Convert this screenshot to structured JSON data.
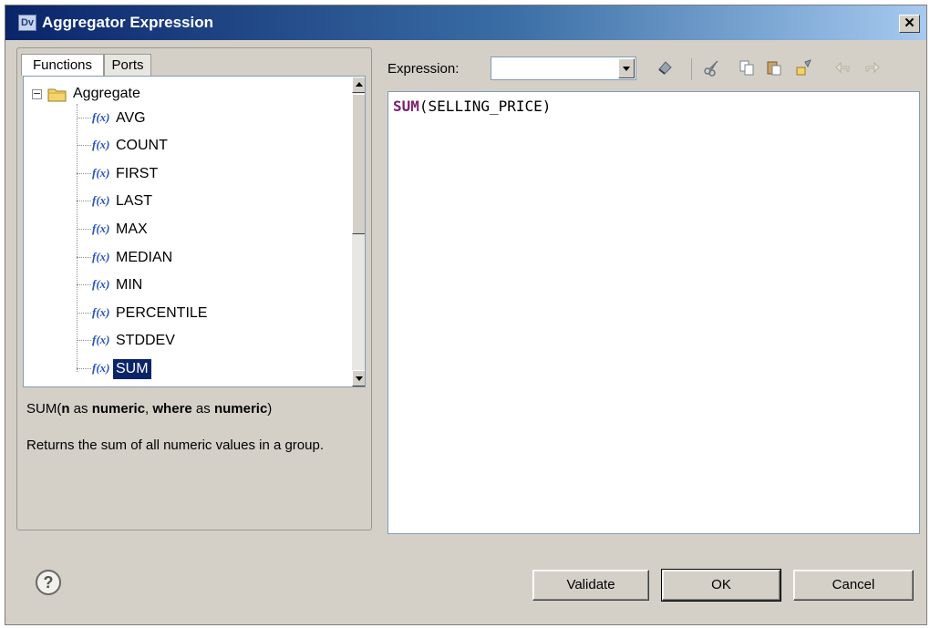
{
  "window": {
    "app_badge": "Dv",
    "title": "Aggregator Expression",
    "close_glyph": "✕"
  },
  "tabs": [
    {
      "label": "Functions"
    },
    {
      "label": "Ports"
    }
  ],
  "tree": {
    "expander": "−",
    "root_label": "Aggregate",
    "fx_glyph": "f(x)",
    "items": [
      {
        "label": "AVG"
      },
      {
        "label": "COUNT"
      },
      {
        "label": "FIRST"
      },
      {
        "label": "LAST"
      },
      {
        "label": "MAX"
      },
      {
        "label": "MEDIAN"
      },
      {
        "label": "MIN"
      },
      {
        "label": "PERCENTILE"
      },
      {
        "label": "STDDEV"
      },
      {
        "label": "SUM"
      }
    ],
    "selected": "SUM"
  },
  "description": {
    "sig_func": "SUM(",
    "sig_arg1": "n",
    "sig_as1": " as ",
    "sig_type1": "numeric",
    "sig_comma": ", ",
    "sig_arg2": "where",
    "sig_as2": " as ",
    "sig_type2": "numeric",
    "sig_close": ")",
    "text": "Returns the sum of all numeric values in a group."
  },
  "expression": {
    "label": "Expression:",
    "combo_value": "",
    "keyword": "SUM",
    "rest": "(SELLING_PRICE)"
  },
  "toolbar_icons": [
    "eraser-icon",
    "cut-icon",
    "copy-icon",
    "paste-icon",
    "format-icon",
    "undo-icon",
    "redo-icon"
  ],
  "buttons": {
    "validate": "Validate",
    "ok": "OK",
    "cancel": "Cancel",
    "help": "?"
  }
}
